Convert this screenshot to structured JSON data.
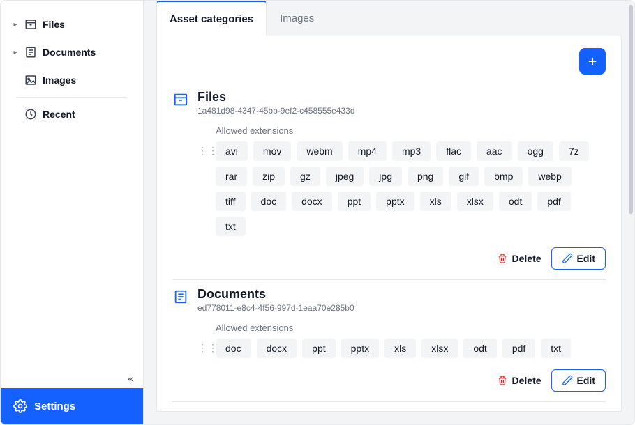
{
  "sidebar": {
    "items": [
      {
        "label": "Files",
        "icon": "archive-icon",
        "expandable": true
      },
      {
        "label": "Documents",
        "icon": "list-icon",
        "expandable": true
      },
      {
        "label": "Images",
        "icon": "image-icon",
        "expandable": false
      },
      {
        "label": "Recent",
        "icon": "clock-icon",
        "expandable": false
      }
    ],
    "settings_label": "Settings"
  },
  "tabs": [
    {
      "label": "Asset categories",
      "active": true
    },
    {
      "label": "Images",
      "active": false
    }
  ],
  "allowed_label": "Allowed extensions",
  "delete_label": "Delete",
  "edit_label": "Edit",
  "categories": [
    {
      "title": "Files",
      "id": "1a481d98-4347-45bb-9ef2-c458555e433d",
      "icon": "archive-icon",
      "extensions": [
        "avi",
        "mov",
        "webm",
        "mp4",
        "mp3",
        "flac",
        "aac",
        "ogg",
        "7z",
        "rar",
        "zip",
        "gz",
        "jpeg",
        "jpg",
        "png",
        "gif",
        "bmp",
        "webp",
        "tiff",
        "doc",
        "docx",
        "ppt",
        "pptx",
        "xls",
        "xlsx",
        "odt",
        "pdf",
        "txt"
      ]
    },
    {
      "title": "Documents",
      "id": "ed778011-e8c4-4f56-997d-1eaa70e285b0",
      "icon": "list-icon",
      "extensions": [
        "doc",
        "docx",
        "ppt",
        "pptx",
        "xls",
        "xlsx",
        "odt",
        "pdf",
        "txt"
      ]
    }
  ]
}
